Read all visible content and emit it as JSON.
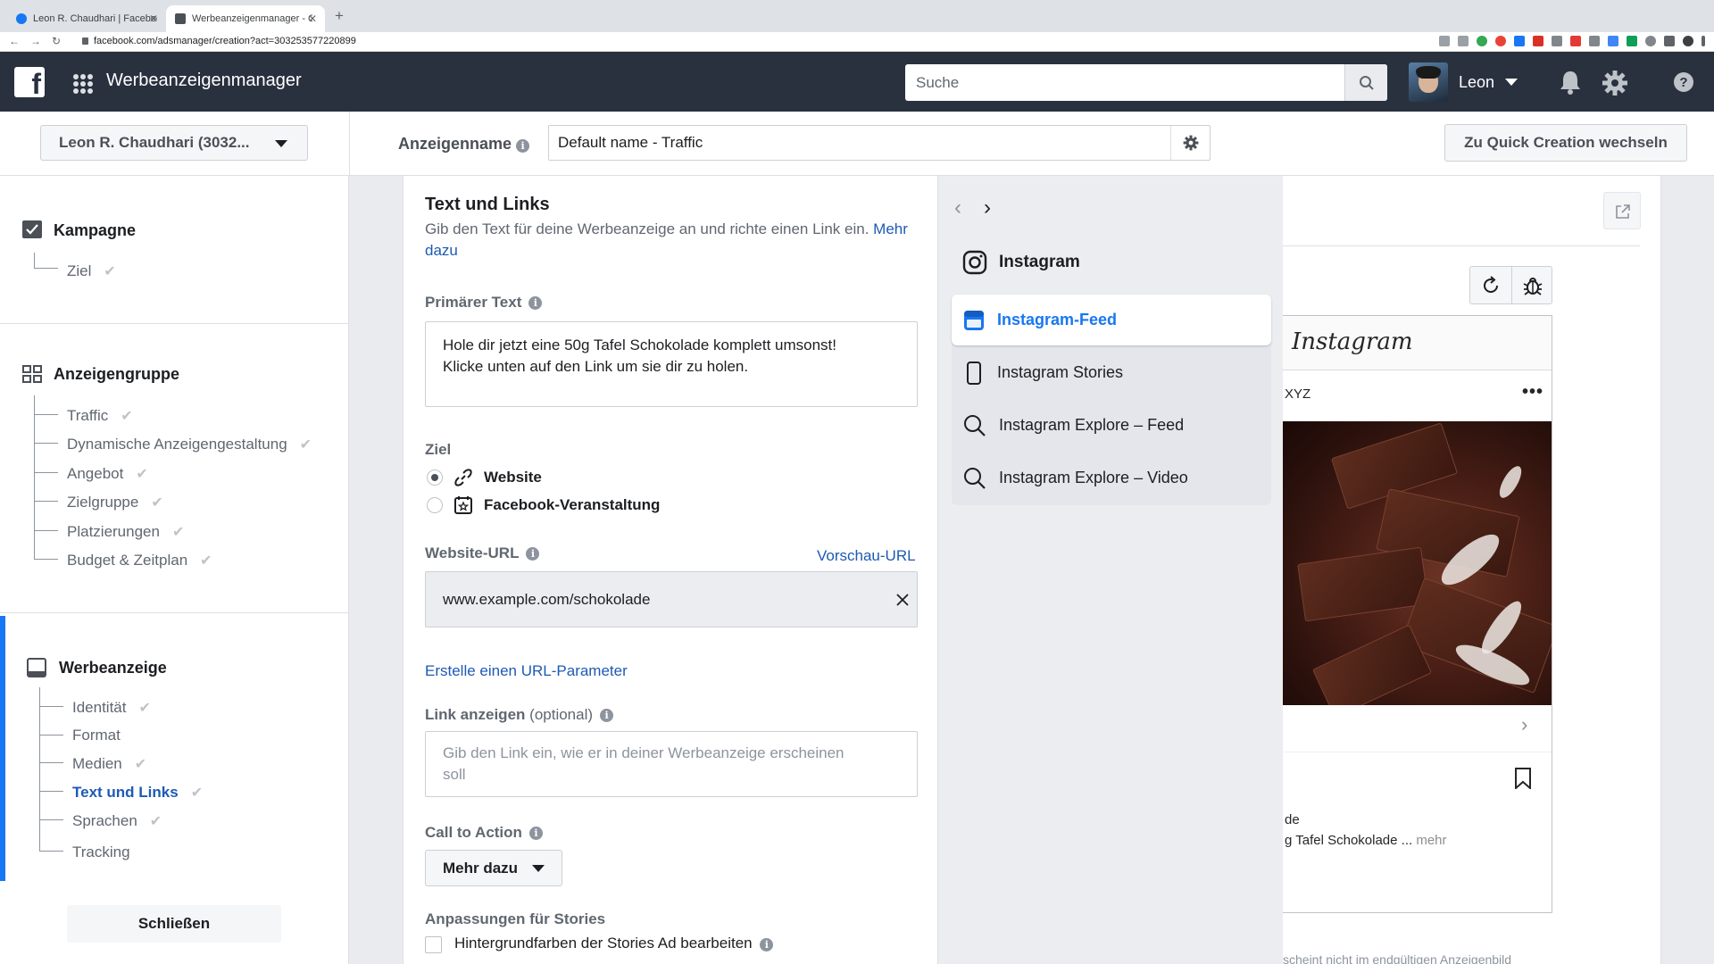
{
  "browser": {
    "tabs": [
      {
        "title": "Leon R. Chaudhari | Facebook",
        "active": false
      },
      {
        "title": "Werbeanzeigenmanager - Cre...",
        "active": true
      }
    ],
    "url": "facebook.com/adsmanager/creation?act=303253577220899"
  },
  "header": {
    "app_title": "Werbeanzeigenmanager",
    "search_placeholder": "Suche",
    "user_name": "Leon"
  },
  "subheader": {
    "account": "Leon R. Chaudhari (3032...",
    "ad_name_label": "Anzeigenname",
    "ad_name_value": "Default name - Traffic",
    "quick_creation_label": "Zu Quick Creation wechseln"
  },
  "sidebar": {
    "campaign": {
      "title": "Kampagne",
      "items": [
        "Ziel"
      ]
    },
    "adset": {
      "title": "Anzeigengruppe",
      "items": [
        "Traffic",
        "Dynamische Anzeigengestaltung",
        "Angebot",
        "Zielgruppe",
        "Platzierungen",
        "Budget & Zeitplan"
      ]
    },
    "ad": {
      "title": "Werbeanzeige",
      "items": [
        "Identität",
        "Format",
        "Medien",
        "Text und Links",
        "Sprachen",
        "Tracking"
      ]
    },
    "close_label": "Schließen"
  },
  "editor": {
    "title": "Text und Links",
    "description": "Gib den Text für deine Werbeanzeige an und richte einen Link ein.",
    "description_link": "Mehr dazu",
    "primary_text_label": "Primärer Text",
    "primary_text_line1": "Hole dir jetzt eine 50g Tafel Schokolade komplett umsonst!",
    "primary_text_line2": "Klicke unten auf den Link um sie dir zu holen.",
    "destination_label": "Ziel",
    "destination_options": [
      "Website",
      "Facebook-Veranstaltung"
    ],
    "website_url_label": "Website-URL",
    "preview_url_link": "Vorschau-URL",
    "website_url_value": "www.example.com/schokolade",
    "url_param_link": "Erstelle einen URL-Parameter",
    "display_link_label": "Link anzeigen",
    "display_link_optional": "(optional)",
    "display_link_placeholder_line1": "Gib den Link ein, wie er in deiner Werbeanzeige erscheinen",
    "display_link_placeholder_line2": "soll",
    "cta_label": "Call to Action",
    "cta_value": "Mehr dazu",
    "stories_label": "Anpassungen für Stories",
    "stories_checkbox_label": "Hintergrundfarben der Stories Ad bearbeiten"
  },
  "placements": {
    "heading": "Instagram",
    "items": [
      "Instagram-Feed",
      "Instagram Stories",
      "Instagram Explore – Feed",
      "Instagram Explore – Video"
    ],
    "selected": "Instagram-Feed"
  },
  "preview": {
    "ig_logo": "Instagram",
    "username_fragment": "XYZ",
    "caption_line1": "de",
    "caption_line2": "g Tafel Schokolade ...",
    "caption_more": "mehr",
    "footnote": "scheint nicht im endgültigen Anzeigenbild"
  },
  "colors": {
    "header_bg": "#29313f",
    "accent_blue": "#1877f2",
    "link_blue": "#1d5ab4",
    "panel_gray": "#ebedf0"
  }
}
